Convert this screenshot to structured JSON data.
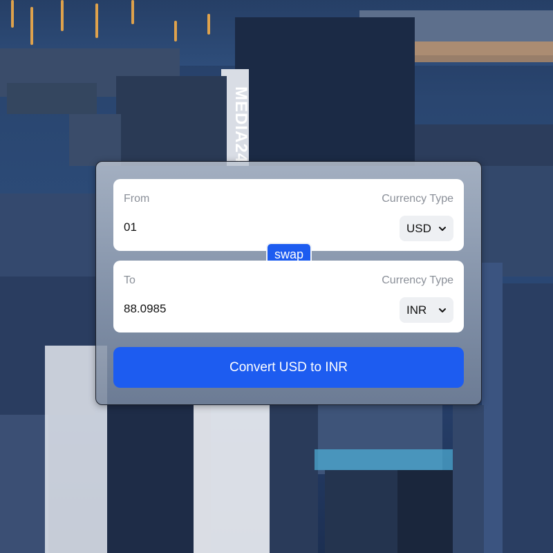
{
  "converter": {
    "from": {
      "label": "From",
      "currency_type_label": "Currency Type",
      "amount": "01",
      "currency": "USD"
    },
    "to": {
      "label": "To",
      "currency_type_label": "Currency Type",
      "amount": "88.0985",
      "currency": "INR"
    },
    "swap_label": "swap",
    "convert_label": "Convert USD to INR"
  },
  "background": {
    "sign_text": "MEDIA24"
  },
  "colors": {
    "accent": "#1d5cf0",
    "panel": "#ffffff",
    "label": "#8a8f98"
  }
}
